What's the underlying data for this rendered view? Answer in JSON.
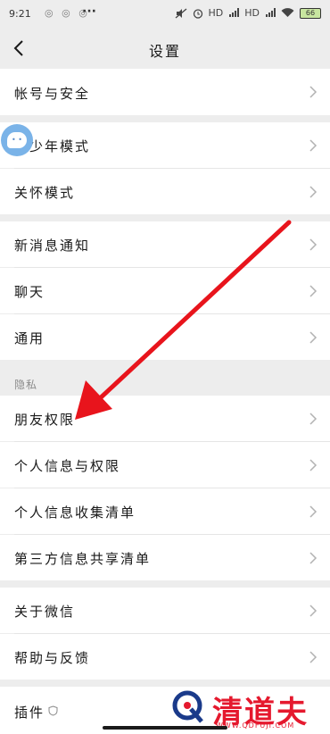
{
  "status_bar": {
    "time": "9:21",
    "left_icons": "◎ ◎ ◎",
    "more": "···",
    "right_indicators": [
      "HD",
      "HD"
    ],
    "battery": "66"
  },
  "nav": {
    "title": "设置"
  },
  "group1": [
    {
      "label": "帐号与安全"
    }
  ],
  "group2": [
    {
      "label": "青少年模式"
    },
    {
      "label": "关怀模式"
    }
  ],
  "group3": [
    {
      "label": "新消息通知"
    },
    {
      "label": "聊天"
    },
    {
      "label": "通用"
    }
  ],
  "privacy": {
    "section_label": "隐私",
    "items": [
      {
        "label": "朋友权限"
      },
      {
        "label": "个人信息与权限"
      },
      {
        "label": "个人信息收集清单"
      },
      {
        "label": "第三方信息共享清单"
      }
    ]
  },
  "group5": [
    {
      "label": "关于微信"
    },
    {
      "label": "帮助与反馈"
    }
  ],
  "group6": [
    {
      "label": "插件"
    }
  ],
  "watermark": {
    "brand": "清道夫",
    "url": "WWW.QDFUJI.COM"
  },
  "colors": {
    "arrow": "#e8141c",
    "watermark": "#e5192e",
    "background": "#ededed"
  }
}
